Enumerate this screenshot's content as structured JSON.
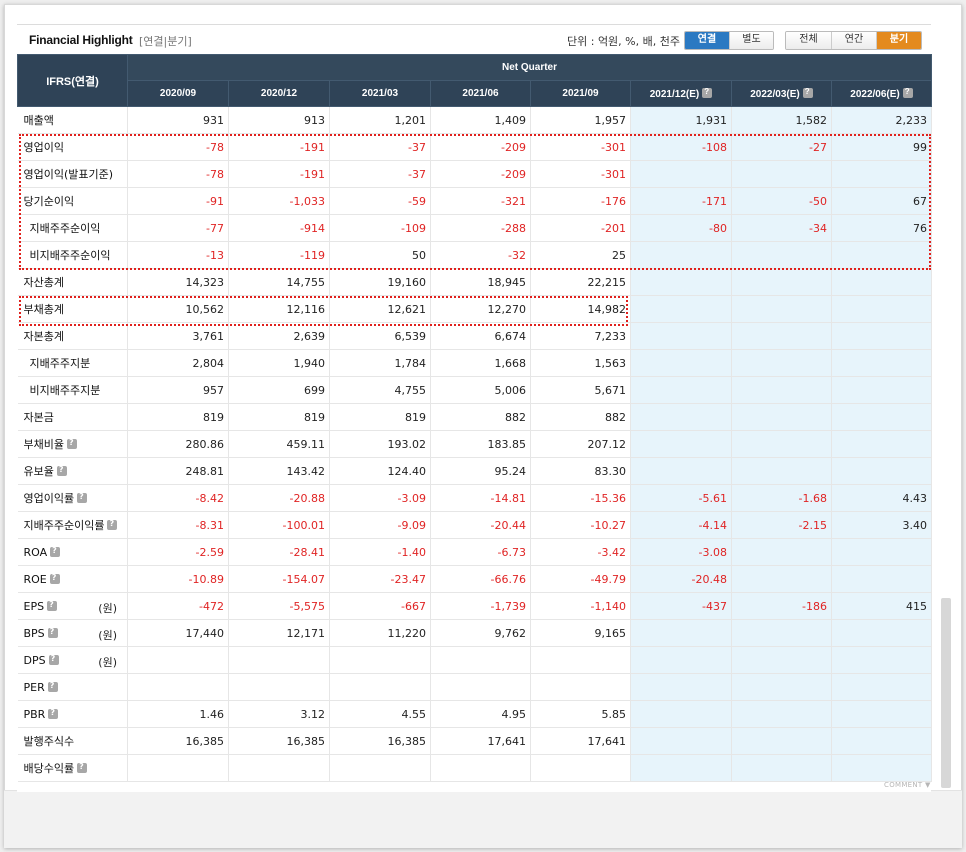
{
  "header": {
    "title": "Financial Highlight",
    "subtitle": "[연결|분기]",
    "unit": "단위 : 억원, %, 배, 천주",
    "basis_tabs": [
      {
        "label": "연결",
        "active": true
      },
      {
        "label": "별도",
        "active": false
      }
    ],
    "period_tabs": [
      {
        "label": "전체",
        "active": false
      },
      {
        "label": "연간",
        "active": false
      },
      {
        "label": "분기",
        "active": true
      }
    ]
  },
  "table": {
    "corner": "IFRS(연결)",
    "group_label": "Net Quarter",
    "columns": [
      "2020/09",
      "2020/12",
      "2021/03",
      "2021/06",
      "2021/09",
      "2021/12(E)",
      "2022/03(E)",
      "2022/06(E)"
    ],
    "rows": [
      {
        "label": "매출액",
        "values": [
          "931",
          "913",
          "1,201",
          "1,409",
          "1,957",
          "1,931",
          "1,582",
          "2,233"
        ]
      },
      {
        "label": "영업이익",
        "values": [
          "-78",
          "-191",
          "-37",
          "-209",
          "-301",
          "-108",
          "-27",
          "99"
        ]
      },
      {
        "label": "영업이익(발표기준)",
        "values": [
          "-78",
          "-191",
          "-37",
          "-209",
          "-301",
          "",
          "",
          ""
        ]
      },
      {
        "label": "당기순이익",
        "values": [
          "-91",
          "-1,033",
          "-59",
          "-321",
          "-176",
          "-171",
          "-50",
          "67"
        ]
      },
      {
        "label": "지배주주순이익",
        "indent": true,
        "values": [
          "-77",
          "-914",
          "-109",
          "-288",
          "-201",
          "-80",
          "-34",
          "76"
        ]
      },
      {
        "label": "비지배주주순이익",
        "indent": true,
        "values": [
          "-13",
          "-119",
          "50",
          "-32",
          "25",
          "",
          "",
          ""
        ]
      },
      {
        "label": "자산총계",
        "values": [
          "14,323",
          "14,755",
          "19,160",
          "18,945",
          "22,215",
          "",
          "",
          ""
        ]
      },
      {
        "label": "부채총계",
        "values": [
          "10,562",
          "12,116",
          "12,621",
          "12,270",
          "14,982",
          "",
          "",
          ""
        ]
      },
      {
        "label": "자본총계",
        "values": [
          "3,761",
          "2,639",
          "6,539",
          "6,674",
          "7,233",
          "",
          "",
          ""
        ]
      },
      {
        "label": "지배주주지분",
        "indent": true,
        "values": [
          "2,804",
          "1,940",
          "1,784",
          "1,668",
          "1,563",
          "",
          "",
          ""
        ]
      },
      {
        "label": "비지배주주지분",
        "indent": true,
        "values": [
          "957",
          "699",
          "4,755",
          "5,006",
          "5,671",
          "",
          "",
          ""
        ]
      },
      {
        "label": "자본금",
        "values": [
          "819",
          "819",
          "819",
          "882",
          "882",
          "",
          "",
          ""
        ]
      },
      {
        "label": "부채비율",
        "help": true,
        "values": [
          "280.86",
          "459.11",
          "193.02",
          "183.85",
          "207.12",
          "",
          "",
          ""
        ]
      },
      {
        "label": "유보율",
        "help": true,
        "values": [
          "248.81",
          "143.42",
          "124.40",
          "95.24",
          "83.30",
          "",
          "",
          ""
        ]
      },
      {
        "label": "영업이익률",
        "help": true,
        "values": [
          "-8.42",
          "-20.88",
          "-3.09",
          "-14.81",
          "-15.36",
          "-5.61",
          "-1.68",
          "4.43"
        ]
      },
      {
        "label": "지배주주순이익률",
        "help": true,
        "values": [
          "-8.31",
          "-100.01",
          "-9.09",
          "-20.44",
          "-10.27",
          "-4.14",
          "-2.15",
          "3.40"
        ]
      },
      {
        "label": "ROA",
        "help": true,
        "values": [
          "-2.59",
          "-28.41",
          "-1.40",
          "-6.73",
          "-3.42",
          "-3.08",
          "",
          ""
        ]
      },
      {
        "label": "ROE",
        "help": true,
        "values": [
          "-10.89",
          "-154.07",
          "-23.47",
          "-66.76",
          "-49.79",
          "-20.48",
          "",
          ""
        ]
      },
      {
        "label": "EPS",
        "help": true,
        "unit": "(원)",
        "values": [
          "-472",
          "-5,575",
          "-667",
          "-1,739",
          "-1,140",
          "-437",
          "-186",
          "415"
        ]
      },
      {
        "label": "BPS",
        "help": true,
        "unit": "(원)",
        "values": [
          "17,440",
          "12,171",
          "11,220",
          "9,762",
          "9,165",
          "",
          "",
          ""
        ]
      },
      {
        "label": "DPS",
        "help": true,
        "unit": "(원)",
        "values": [
          "",
          "",
          "",
          "",
          "",
          "",
          "",
          ""
        ]
      },
      {
        "label": "PER",
        "help": true,
        "values": [
          "",
          "",
          "",
          "",
          "",
          "",
          "",
          ""
        ]
      },
      {
        "label": "PBR",
        "help": true,
        "values": [
          "1.46",
          "3.12",
          "4.55",
          "4.95",
          "5.85",
          "",
          "",
          ""
        ]
      },
      {
        "label": "발행주식수",
        "values": [
          "16,385",
          "16,385",
          "16,385",
          "17,641",
          "17,641",
          "",
          "",
          ""
        ]
      },
      {
        "label": "배당수익률",
        "help": true,
        "values": [
          "",
          "",
          "",
          "",
          "",
          "",
          "",
          ""
        ]
      }
    ]
  },
  "footer": {
    "comment_label": "COMMENT ▼"
  },
  "colors": {
    "header_bg": "#2f4357",
    "estimate_bg": "#e7f4fb",
    "negative": "#e02424",
    "highlight": "#e0201c",
    "tab_blue": "#2b79c2",
    "tab_orange": "#e48a1e"
  }
}
